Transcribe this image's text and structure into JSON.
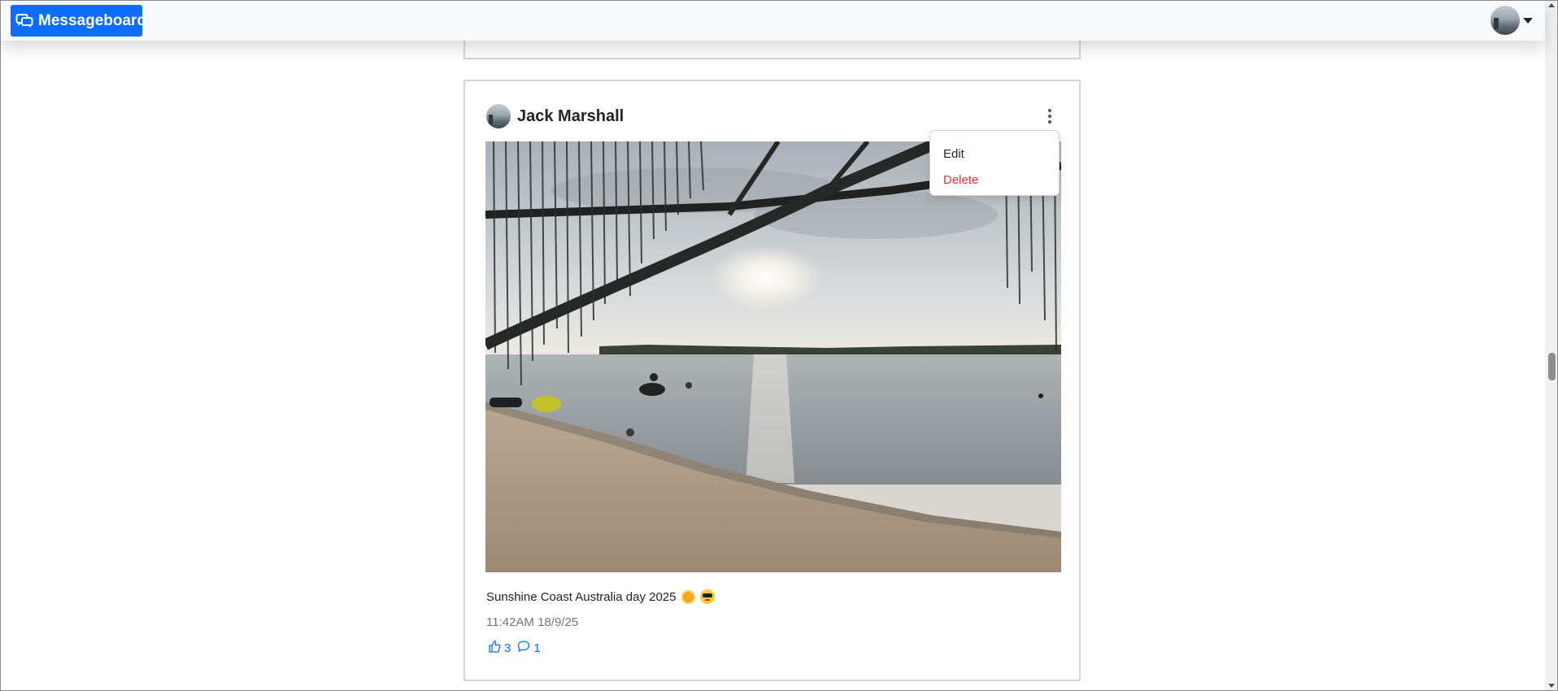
{
  "navbar": {
    "brand_label": "Messageboard",
    "brand_icon": "chat-bubbles-icon",
    "user_avatar": "user-avatar",
    "user_menu_caret": "caret-down-icon"
  },
  "post": {
    "author": "Jack Marshall",
    "caption": "Sunshine Coast Australia day 2025",
    "caption_emojis": [
      "sun-emoji",
      "smiling-face-with-sunglasses-emoji"
    ],
    "timestamp": "11:42AM 18/9/25",
    "likes": "3",
    "comments": "1",
    "image_alt": "Beach at sunset with tree branches over water"
  },
  "menu": {
    "items": [
      {
        "label": "Edit",
        "color": "#212529"
      },
      {
        "label": "Delete",
        "color": "#dc3545"
      }
    ]
  },
  "colors": {
    "primary": "#0d6efd",
    "danger": "#dc3545",
    "muted": "#6c757d"
  }
}
